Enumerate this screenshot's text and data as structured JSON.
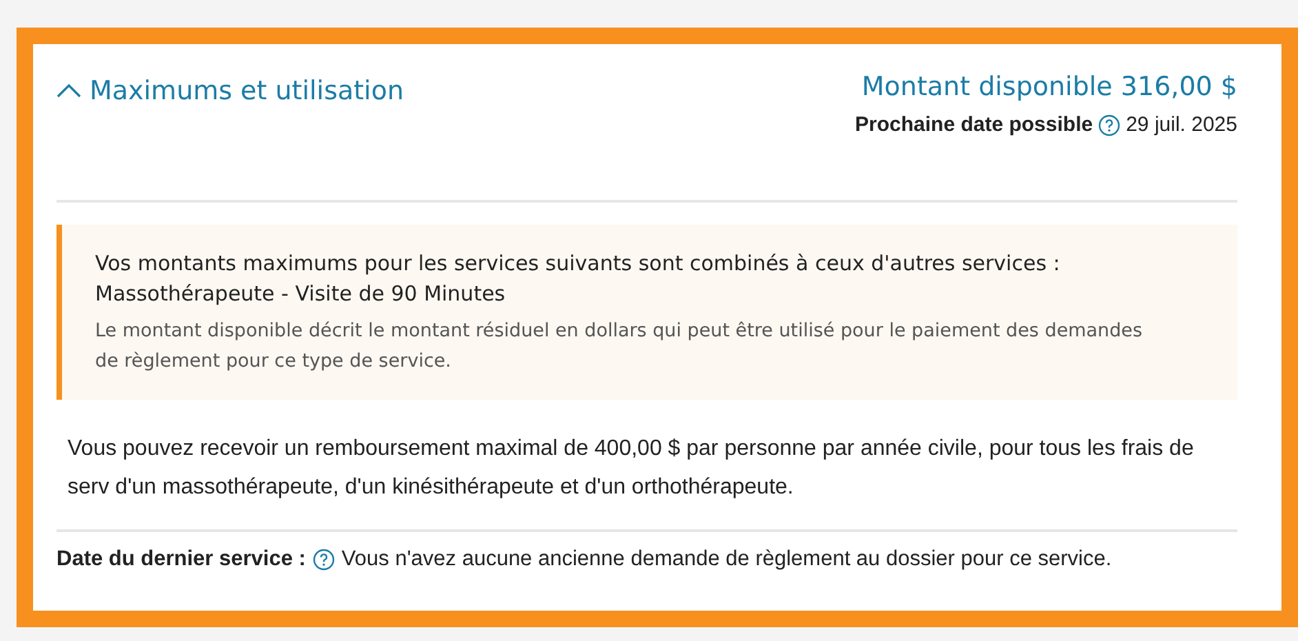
{
  "section": {
    "title": "Maximums et utilisation",
    "expanded": true,
    "available": "Montant disponible 316,00 $",
    "next_date_label": "Prochaine date possible",
    "next_date": "29 juil. 2025"
  },
  "notice": {
    "heading": "Vos montants maximums pour les services suivants sont combinés à ceux d'autres services :",
    "service": "Massothérapeute - Visite de 90 Minutes",
    "description": "Le montant disponible décrit le montant résiduel en dollars qui peut être utilisé pour le paiement des demandes de règlement pour ce type de service."
  },
  "limit_text": "Vous pouvez recevoir un remboursement maximal de 400,00 $ par personne par année civile, pour tous les frais de serv d'un massothérapeute, d'un kinésithérapeute et d'un orthothérapeute.",
  "last_service": {
    "label": "Date du dernier service :",
    "text": "Vous n'avez aucune ancienne demande de règlement au dossier pour ce service."
  }
}
